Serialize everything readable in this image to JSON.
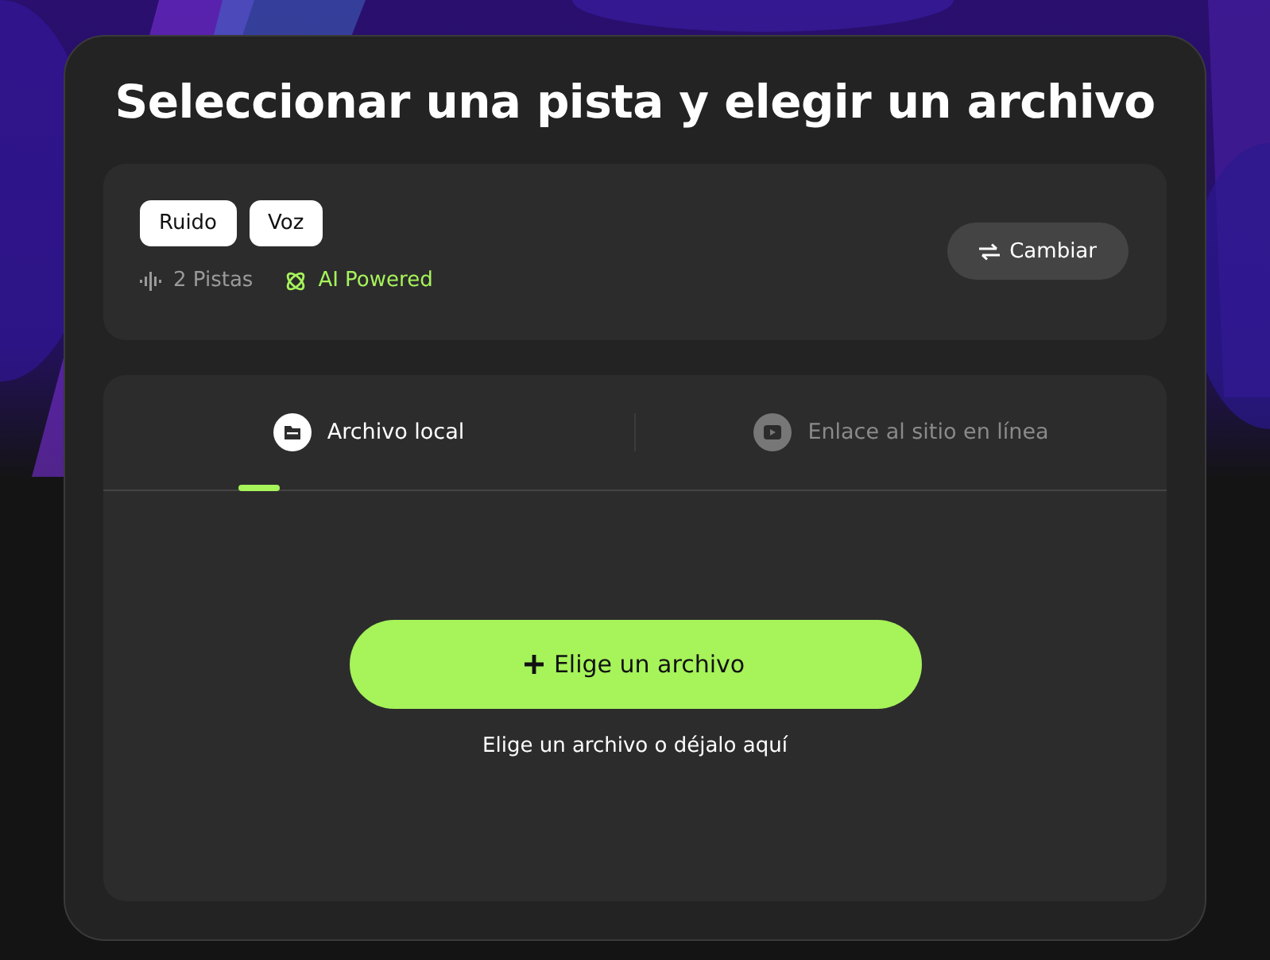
{
  "title": "Seleccionar una pista y elegir un archivo",
  "track": {
    "tags": [
      "Ruido",
      "Voz"
    ],
    "count": "2 Pistas",
    "badge": "AI Powered",
    "switch_button": "Cambiar"
  },
  "tabs": [
    {
      "label": "Archivo local",
      "kind": "file",
      "selected": true
    },
    {
      "label": "Enlace al sitio en línea",
      "kind": "video",
      "selected": false
    }
  ],
  "upload": {
    "button": "Elige un archivo",
    "hint": "Elige un archivo o déjalo aquí"
  }
}
